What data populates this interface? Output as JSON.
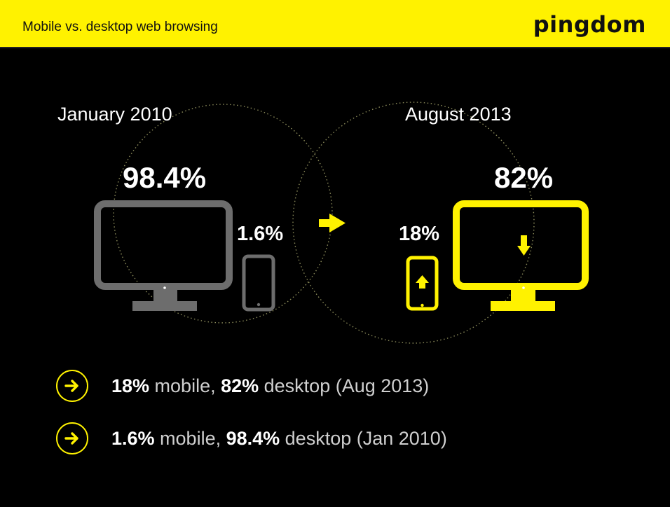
{
  "header": {
    "title": "Mobile vs. desktop web browsing",
    "brand": "pingdom"
  },
  "comparison": {
    "before": {
      "period": "January 2010",
      "desktop": "98.4%",
      "mobile": "1.6%"
    },
    "after": {
      "period": "August 2013",
      "desktop": "82%",
      "mobile": "18%"
    }
  },
  "summary": [
    {
      "mobile_value": "18%",
      "mobile_label": " mobile, ",
      "desktop_value": "82%",
      "desktop_label": " desktop (Aug 2013)"
    },
    {
      "mobile_value": "1.6%",
      "mobile_label": " mobile, ",
      "desktop_value": "98.4%",
      "desktop_label": " desktop (Jan 2010)"
    }
  ],
  "colors": {
    "accent": "#fff200",
    "muted_device": "#6d6d6d",
    "background": "#000000"
  },
  "icons": [
    "arrow-right-icon",
    "desktop-monitor-icon",
    "smartphone-icon",
    "arrow-down-icon",
    "arrow-up-icon"
  ]
}
